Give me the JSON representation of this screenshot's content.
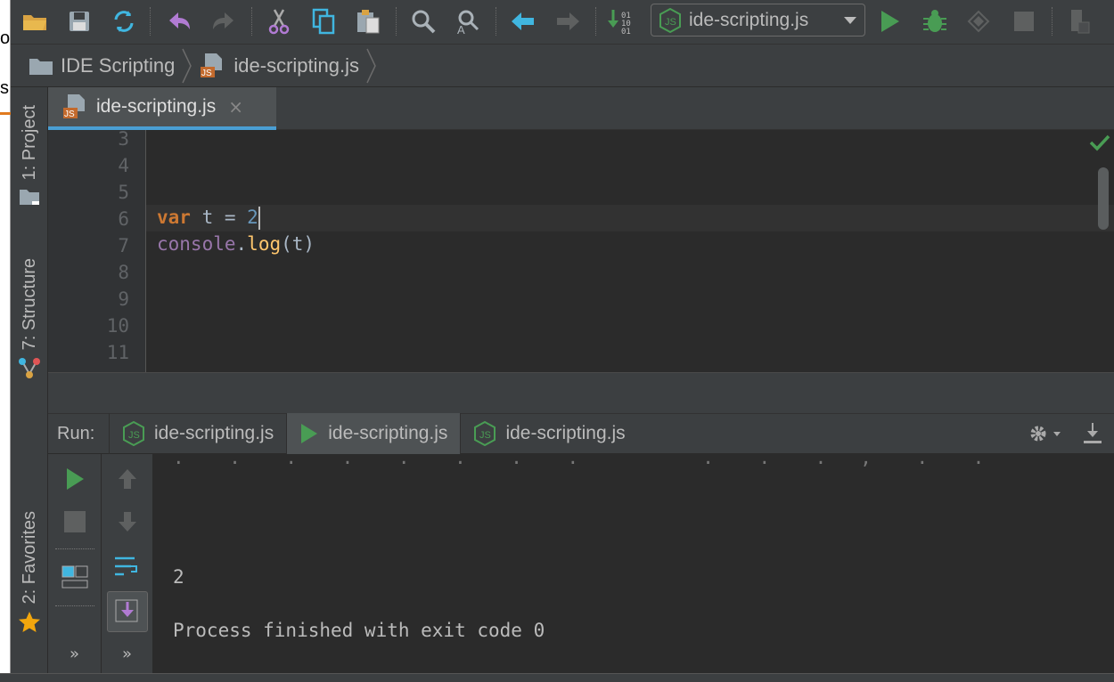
{
  "left_strip": {
    "chars": [
      "o",
      "s"
    ]
  },
  "toolbar": {
    "icons": [
      "open-folder-icon",
      "save-icon",
      "sync-icon",
      "undo-icon",
      "redo-icon",
      "cut-icon",
      "copy-icon",
      "paste-icon",
      "find-icon",
      "replace-icon",
      "back-icon",
      "forward-icon",
      "build-icon",
      "run-icon",
      "debug-icon",
      "coverage-icon",
      "stop-icon",
      "project-structure-icon"
    ],
    "run_config": "ide-scripting.js"
  },
  "breadcrumb": {
    "items": [
      "IDE Scripting",
      "ide-scripting.js"
    ]
  },
  "side": {
    "project": "1: Project",
    "structure": "7: Structure",
    "favorites": "2: Favorites"
  },
  "editor": {
    "tab": {
      "label": "ide-scripting.js",
      "close": "×"
    },
    "line_numbers": [
      "3",
      "4",
      "5",
      "6",
      "7",
      "8",
      "9",
      "10",
      "11"
    ],
    "code": {
      "kw_var": "var",
      "line6_rest": " t = ",
      "line6_num": "2",
      "line7_obj": "console",
      "line7_dot": ".",
      "line7_fn": "log",
      "line7_rest": "(t)"
    }
  },
  "run": {
    "title": "Run:",
    "tabs": [
      "ide-scripting.js",
      "ide-scripting.js",
      "ide-scripting.js"
    ],
    "more": "»"
  },
  "console": {
    "output_lines": [
      "2",
      "Process finished with exit code 0"
    ]
  },
  "colors": {
    "accent": "#4a9fd4",
    "run_green": "#499c54",
    "keyword": "#cc7832",
    "number": "#6897bb",
    "function": "#ffc66d",
    "object": "#9876aa"
  }
}
